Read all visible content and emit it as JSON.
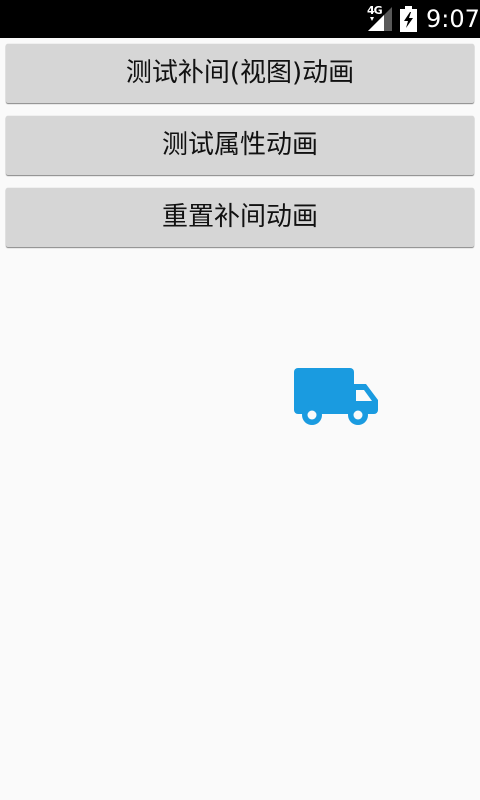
{
  "status_bar": {
    "network_type": "4G",
    "time": "9:07",
    "signal_icon": "signal-bars-icon",
    "battery_icon": "battery-charging-icon"
  },
  "buttons": [
    {
      "label": "测试补间(视图)动画"
    },
    {
      "label": "测试属性动画"
    },
    {
      "label": "重置补间动画"
    }
  ],
  "animated_view": {
    "icon": "truck-icon",
    "color": "#1a9be0"
  },
  "colors": {
    "background": "#fafafa",
    "status_bar": "#000000",
    "button": "#d6d6d6",
    "accent": "#1a9be0"
  }
}
